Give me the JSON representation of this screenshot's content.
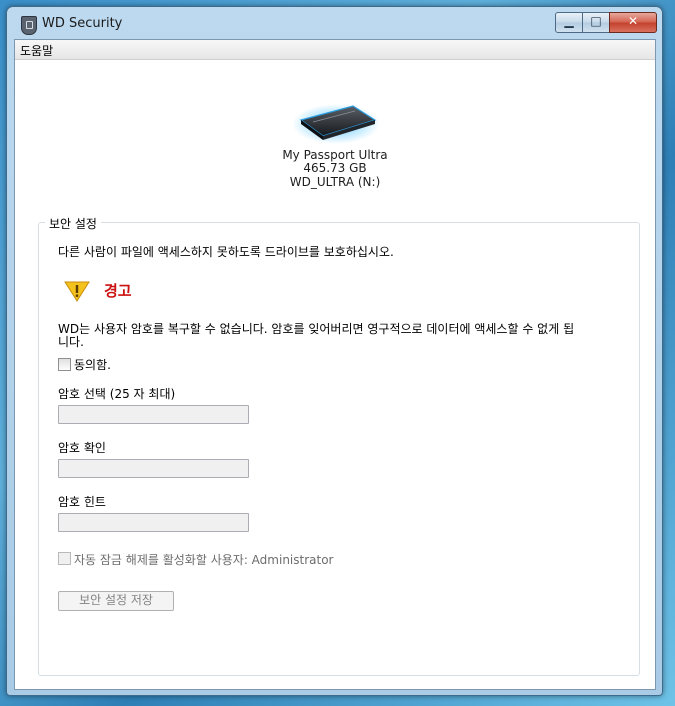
{
  "window": {
    "title": "WD Security",
    "controls": {
      "minimize": "▁",
      "maximize": "□",
      "close": "✕"
    }
  },
  "menu": {
    "help": "도움말"
  },
  "device": {
    "name": "My Passport Ultra",
    "capacity": "465.73 GB",
    "volume": "WD_ULTRA (N:)"
  },
  "security": {
    "group_label": "보안 설정",
    "intro": "다른 사람이 파일에 액세스하지 못하도록 드라이브를 보호하십시오.",
    "warning_title": "경고",
    "warning_line1": "WD는 사용자 암호를 복구할 수 없습니다. 암호를 잊어버리면 영구적으로 데이터에 액세스할 수 없게 됩",
    "warning_line2": "니다.",
    "agree_label": "동의함.",
    "password_label": "암호 선택 (25 자 최대)",
    "confirm_label": "암호 확인",
    "hint_label": "암호 힌트",
    "auto_unlock_label": "자동 잠금 해제를 활성화할 사용자: Administrator",
    "save_button": "보안 설정 저장"
  }
}
